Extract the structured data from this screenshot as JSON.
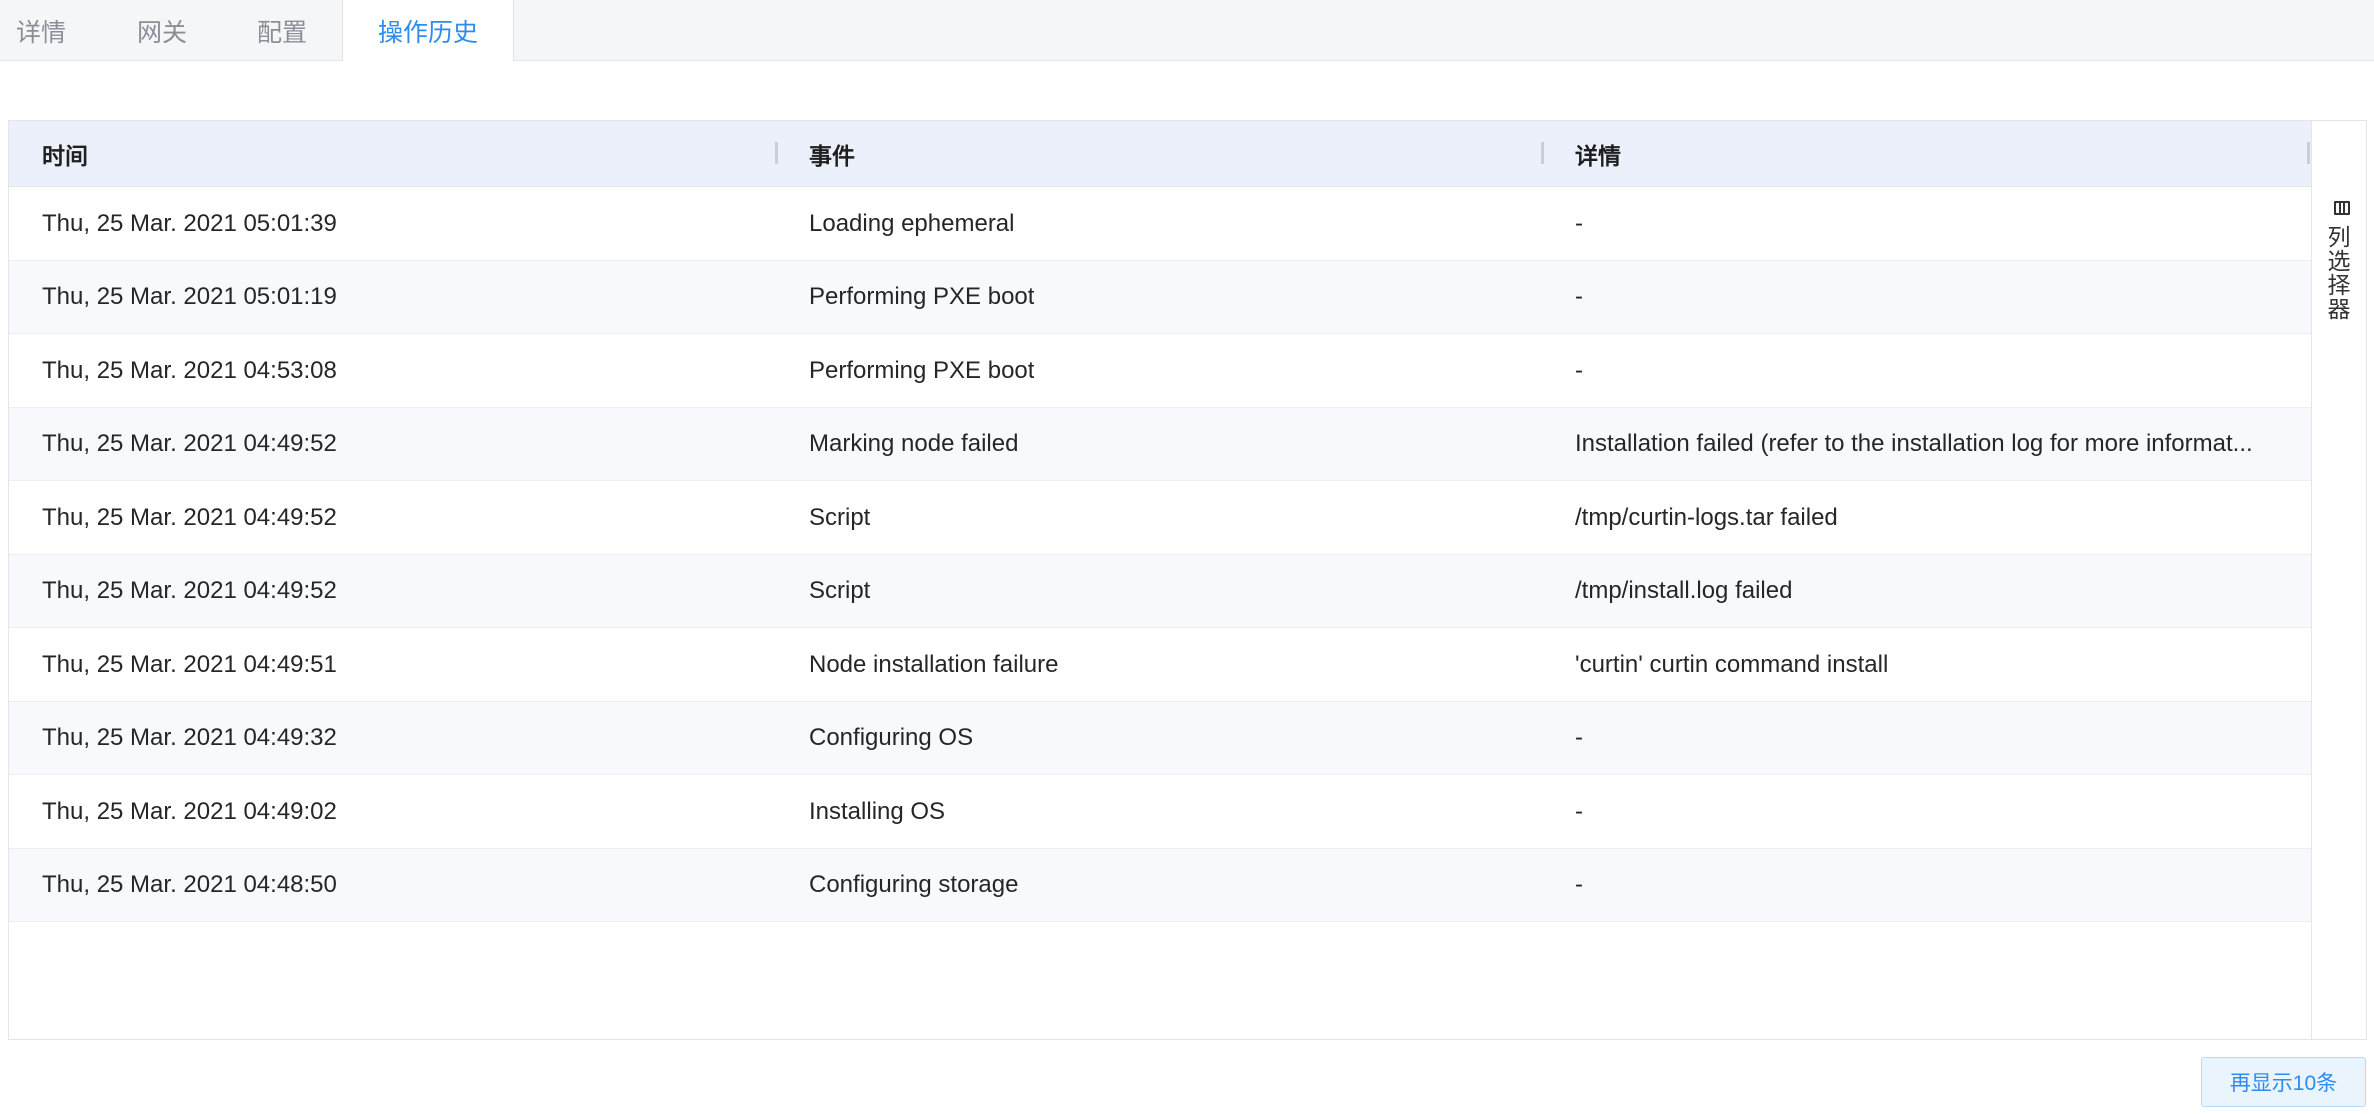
{
  "tabs": [
    {
      "label": "详情",
      "active": false
    },
    {
      "label": "网关",
      "active": false
    },
    {
      "label": "配置",
      "active": false
    },
    {
      "label": "操作历史",
      "active": true
    }
  ],
  "table": {
    "columns": [
      "时间",
      "事件",
      "详情"
    ],
    "rows": [
      {
        "time": "Thu, 25 Mar. 2021 05:01:39",
        "event": "Loading ephemeral",
        "detail": "-"
      },
      {
        "time": "Thu, 25 Mar. 2021 05:01:19",
        "event": "Performing PXE boot",
        "detail": "-"
      },
      {
        "time": "Thu, 25 Mar. 2021 04:53:08",
        "event": "Performing PXE boot",
        "detail": "-"
      },
      {
        "time": "Thu, 25 Mar. 2021 04:49:52",
        "event": "Marking node failed",
        "detail": "Installation failed (refer to the installation log for more informat..."
      },
      {
        "time": "Thu, 25 Mar. 2021 04:49:52",
        "event": "Script",
        "detail": "/tmp/curtin-logs.tar failed"
      },
      {
        "time": "Thu, 25 Mar. 2021 04:49:52",
        "event": "Script",
        "detail": "/tmp/install.log failed"
      },
      {
        "time": "Thu, 25 Mar. 2021 04:49:51",
        "event": "Node installation failure",
        "detail": "'curtin' curtin command install"
      },
      {
        "time": "Thu, 25 Mar. 2021 04:49:32",
        "event": "Configuring OS",
        "detail": "-"
      },
      {
        "time": "Thu, 25 Mar. 2021 04:49:02",
        "event": "Installing OS",
        "detail": "-"
      },
      {
        "time": "Thu, 25 Mar. 2021 04:48:50",
        "event": "Configuring storage",
        "detail": "-"
      }
    ]
  },
  "column_selector": {
    "label": "列选择器",
    "icon": "columns-icon"
  },
  "show_more": {
    "label": "再显示10条"
  },
  "colors": {
    "accent": "#2d8cf0",
    "header_bg": "#ebf0fb",
    "alt_row": "#f8f9fc"
  }
}
